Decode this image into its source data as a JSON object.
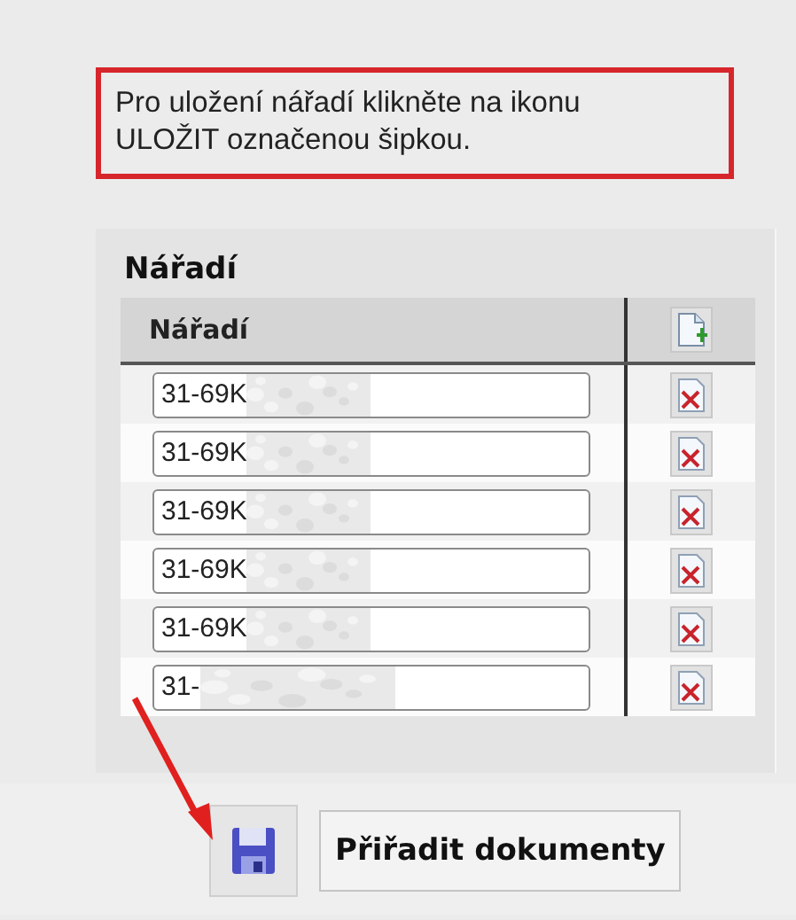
{
  "notice": {
    "text": "Pro uložení nářadí klikněte na ikonu ULOŽIT označenou šipkou."
  },
  "panel": {
    "title": "Nářadí",
    "table": {
      "columns": [
        "Nářadí"
      ],
      "rows": [
        {
          "value": "31-69K",
          "redacted": true
        },
        {
          "value": "31-69K",
          "redacted": true
        },
        {
          "value": "31-69K",
          "redacted": true
        },
        {
          "value": "31-69K",
          "redacted": true
        },
        {
          "value": "31-69K",
          "redacted": true
        },
        {
          "value": "31-",
          "redacted": true
        }
      ]
    }
  },
  "actions": {
    "buttons": [
      {
        "kind": "save"
      },
      {
        "kind": "text",
        "label": "Přiřadit dokumenty"
      }
    ]
  }
}
